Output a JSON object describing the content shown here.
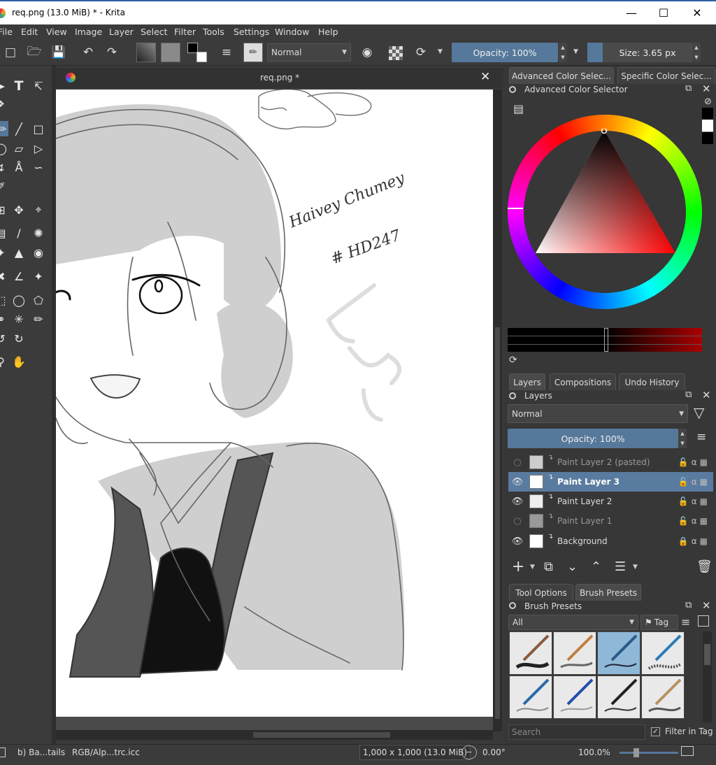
{
  "window": {
    "title": "req.png (13.0 MiB)  * - Krita",
    "minimize": "—",
    "maximize": "☐",
    "close": "✕"
  },
  "menu": [
    "File",
    "Edit",
    "View",
    "Image",
    "Layer",
    "Select",
    "Filter",
    "Tools",
    "Settings",
    "Window",
    "Help"
  ],
  "toolbar": {
    "blend_mode": "Normal",
    "opacity": "Opacity: 100%",
    "size": "Size: 3.65 px"
  },
  "document": {
    "tab_title": "req.png *",
    "signature_line1": "Haivey Chumey",
    "signature_line2": "# HD247"
  },
  "color_panel": {
    "tab_active": "Advanced Color Selec...",
    "tab_other": "Specific Color Selec...",
    "header": "Advanced Color Selector"
  },
  "layers_panel": {
    "tabs": [
      "Layers",
      "Compositions",
      "Undo History"
    ],
    "header": "Layers",
    "blend_mode": "Normal",
    "opacity": "Opacity:  100%",
    "layers": [
      {
        "name": "Paint Layer 2 (pasted)",
        "visible": false,
        "selected": false
      },
      {
        "name": "Paint Layer 3",
        "visible": true,
        "selected": true
      },
      {
        "name": "Paint Layer 2",
        "visible": true,
        "selected": false
      },
      {
        "name": "Paint Layer 1",
        "visible": false,
        "selected": false
      },
      {
        "name": "Background",
        "visible": true,
        "selected": false
      }
    ]
  },
  "brush_panel": {
    "tabs": [
      "Tool Options",
      "Brush Presets"
    ],
    "header": "Brush Presets",
    "filter": "All",
    "tag": "Tag",
    "search_placeholder": "Search",
    "filter_in_tag": "Filter in Tag"
  },
  "status": {
    "layer": "b) Ba...tails",
    "colorspace": "RGB/Alp...trc.icc",
    "dimensions": "1,000 x 1,000 (13.0 MiB)",
    "rotation": "0.00°",
    "zoom": "100.0%"
  },
  "colors": {
    "accent": "#56789a",
    "selected_layer": "#5a7ba0"
  }
}
